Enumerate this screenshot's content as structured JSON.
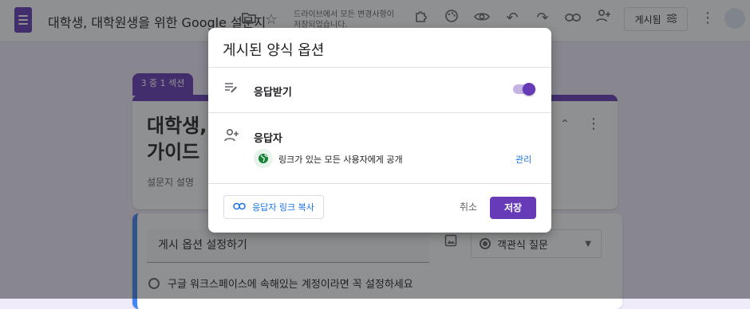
{
  "header": {
    "doc_title": "대학생, 대학원생을 위한 Google 설문지",
    "autosave_status": "드라이브에서 모든 변경사항이 저장되었습니다.",
    "published_label": "게시됨"
  },
  "form": {
    "section_tab": "3 중 1 섹션",
    "title": "대학생, 가이드",
    "description": "설문지 설명",
    "question_placeholder": "게시 옵션 설정하기",
    "question_type": "객관식 질문",
    "option_1": "구글 워크스페이스에 속해있는 계정이라면 꼭 설정하세요"
  },
  "dialog": {
    "title": "게시된 양식 옵션",
    "accept_responses_label": "응답받기",
    "accept_responses_on": true,
    "responders_label": "응답자",
    "access_text": "링크가 있는 모든 사용자에게 공개",
    "manage_link": "관리",
    "copy_link_label": "응답자 링크 복사",
    "cancel_label": "취소",
    "save_label": "저장"
  },
  "colors": {
    "brand": "#673ab7",
    "link": "#1a73e8",
    "globe_green": "#188038"
  },
  "icons": {
    "forms_logo": "google-forms-icon",
    "folder": "folder-icon",
    "star": "star-icon",
    "addon": "puzzle-icon",
    "theme": "palette-icon",
    "preview": "eye-icon",
    "undo": "undo-icon",
    "redo": "redo-icon",
    "link": "link-icon",
    "add_collab": "person-add-icon",
    "tune": "tune-icon",
    "more": "more-vert-icon",
    "responses": "edit-note-icon",
    "responders": "person-add-icon",
    "globe": "globe-icon"
  }
}
